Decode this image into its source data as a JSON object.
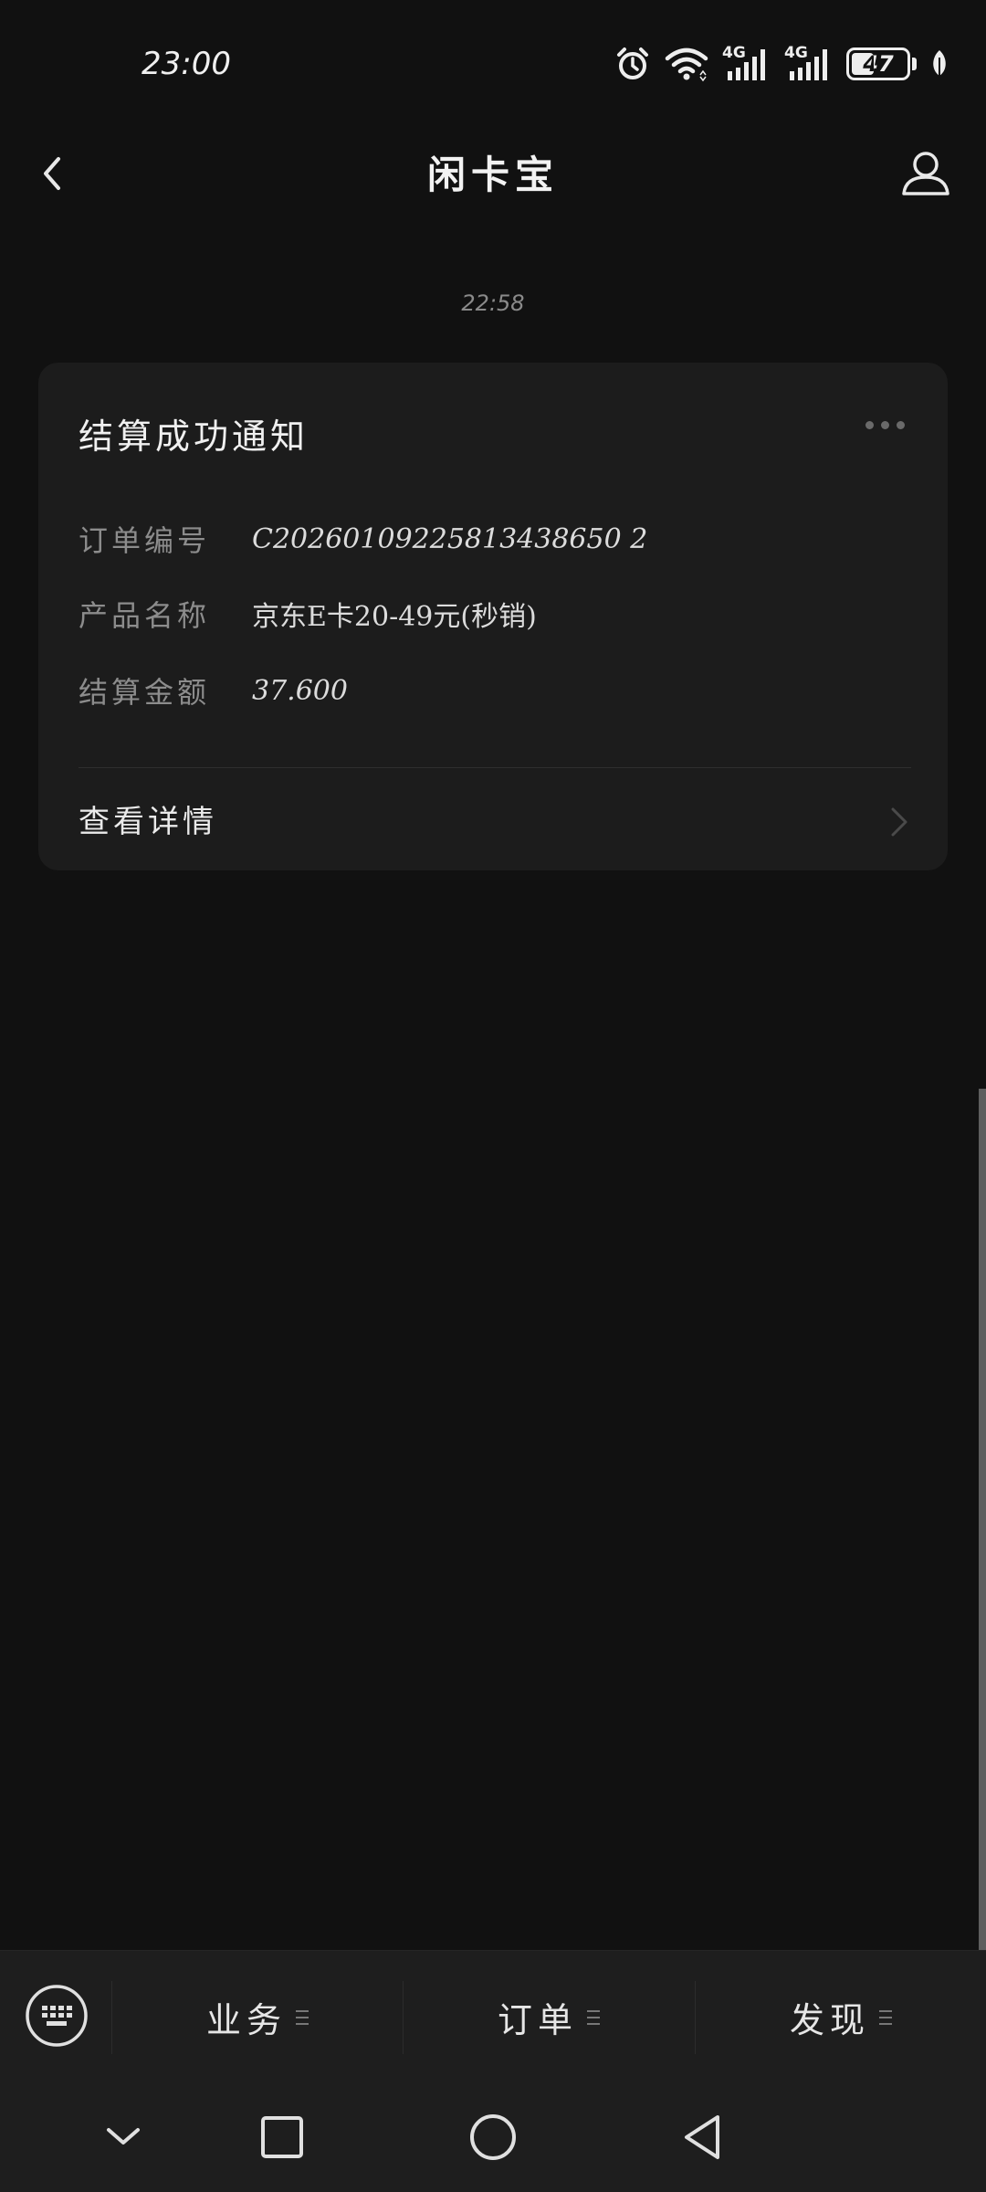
{
  "status_bar": {
    "time": "23:00",
    "battery": "47",
    "battery_level": 0.47,
    "network_label_1": "4G",
    "network_label_2": "4G"
  },
  "header": {
    "title": "闲卡宝"
  },
  "message": {
    "timestamp": "22:58",
    "card": {
      "title": "结算成功通知",
      "fields": [
        {
          "label": "订单编号",
          "value": "C20260109225813438650 2"
        },
        {
          "label": "产品名称",
          "value": "京东E卡20-49元(秒销)"
        },
        {
          "label": "结算金额",
          "value": "37.600"
        }
      ],
      "action_label": "查看详情"
    }
  },
  "bottom_menu": {
    "tabs": [
      {
        "label": "业务"
      },
      {
        "label": "订单"
      },
      {
        "label": "发现"
      }
    ]
  },
  "colors": {
    "background": "#111111",
    "card": "#1c1c1c",
    "menu": "#1e1e1e"
  }
}
